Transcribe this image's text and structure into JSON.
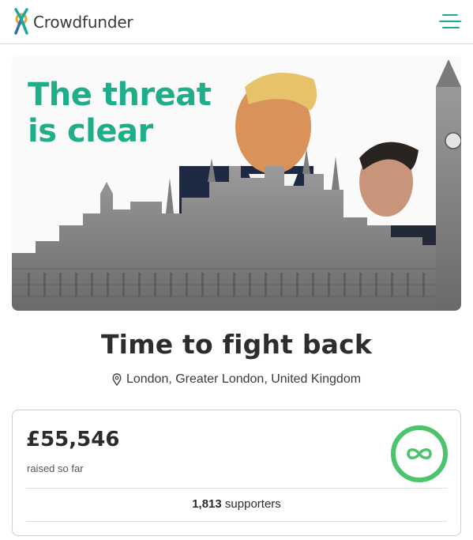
{
  "header": {
    "brand": "Crowdfunder",
    "logo_icon": "crowdfunder-figure-icon",
    "menu_icon": "hamburger-menu-icon",
    "accent_color": "#1aa99b"
  },
  "hero": {
    "headline_line1": "The threat",
    "headline_line2": "is clear",
    "headline_color": "#1fae8a"
  },
  "campaign": {
    "title": "Time to fight back",
    "location_icon": "map-pin-icon",
    "location": "London, Greater London, United Kingdom"
  },
  "funding": {
    "amount": "£55,546",
    "raised_label": "raised so far",
    "progress_icon": "infinity-icon",
    "progress_color": "#4cc46c",
    "supporters_count": "1,813",
    "supporters_label": "supporters"
  }
}
